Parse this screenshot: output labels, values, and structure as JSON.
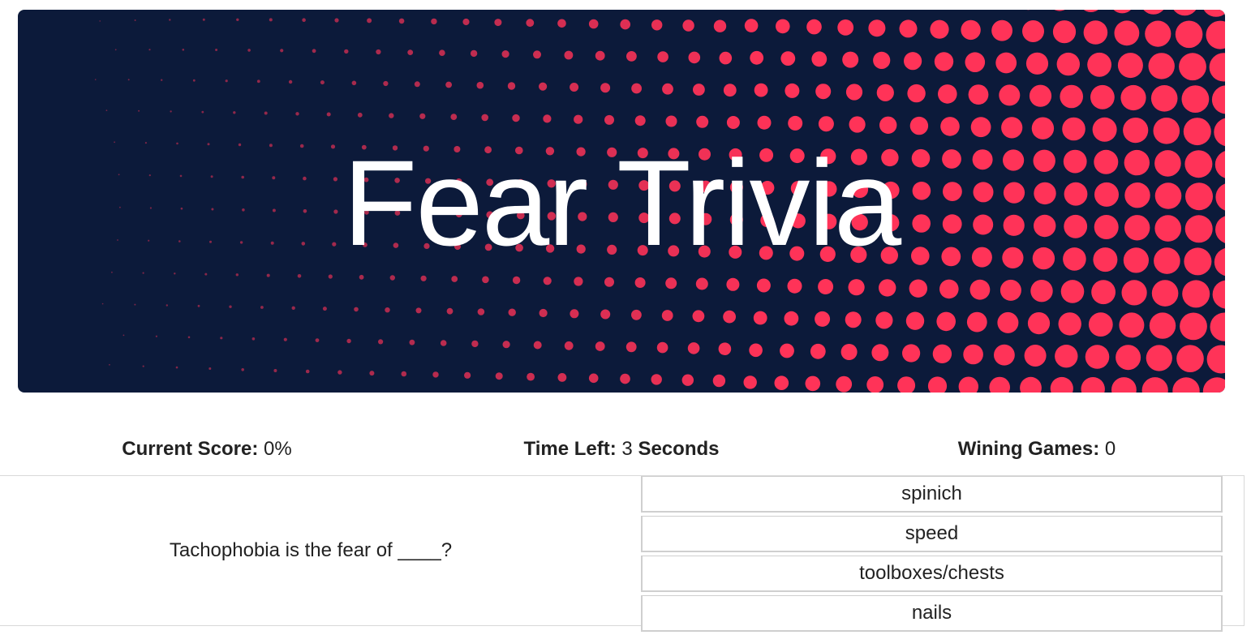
{
  "header": {
    "title": "Fear Trivia",
    "background_color": "#0c1a3a",
    "dot_color": "#ff3358"
  },
  "stats": {
    "score_label": "Current Score:",
    "score_value": "0%",
    "time_label": "Time Left:",
    "time_value": "3",
    "time_unit": "Seconds",
    "wins_label": "Wining Games:",
    "wins_value": "0"
  },
  "quiz": {
    "question": "Tachophobia is the fear of ____?",
    "answers": [
      "spinich",
      "speed",
      "toolboxes/chests",
      "nails"
    ]
  }
}
